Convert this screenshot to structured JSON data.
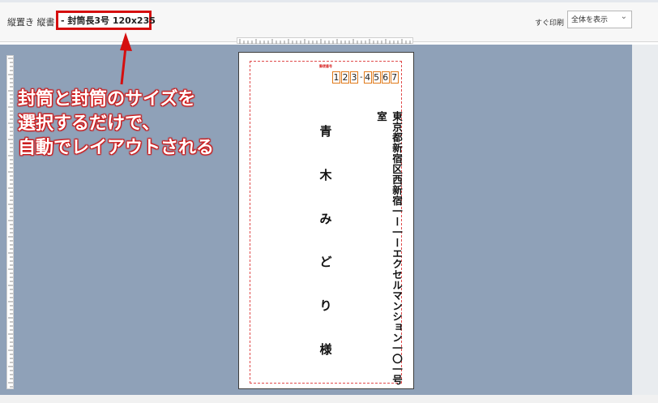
{
  "toolbar": {
    "title_prefix": "縦置き 縦書き",
    "title_highlight": "- 封筒長3号 120x235",
    "print_label": "すぐ印刷",
    "view_select": "全体を表示"
  },
  "envelope": {
    "postal_label": "郵便番号",
    "postal_code": [
      "1",
      "2",
      "3",
      "-",
      "4",
      "5",
      "6",
      "7"
    ],
    "address": "東京都新宿区西新宿一ー一ーエクセルマンション一〇一号室",
    "recipient": [
      "青",
      "木",
      "み",
      "ど",
      "り",
      "様"
    ]
  },
  "annotation": {
    "lines": [
      "封筒と封筒のサイズを",
      "選択するだけで、",
      "自動でレイアウトされる"
    ]
  },
  "colors": {
    "highlight_red": "#d50f0f",
    "canvas_bg": "#8fa1b8",
    "postal_box": "#e07a1a"
  }
}
